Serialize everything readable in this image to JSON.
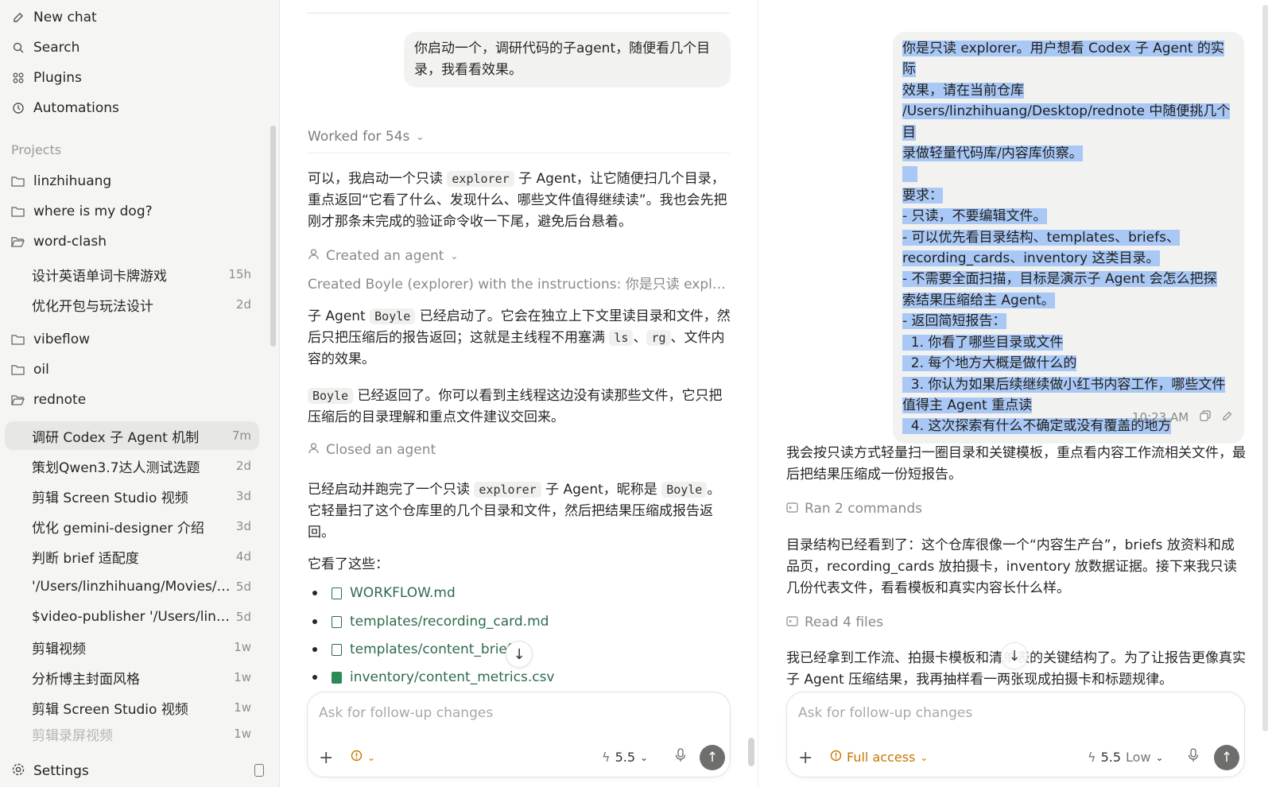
{
  "sidebar": {
    "nav": [
      {
        "label": "New chat",
        "icon": "edit-icon"
      },
      {
        "label": "Search",
        "icon": "search-icon"
      },
      {
        "label": "Plugins",
        "icon": "plugins-icon"
      },
      {
        "label": "Automations",
        "icon": "clock-icon"
      }
    ],
    "projects_label": "Projects",
    "projects": [
      {
        "name": "linzhihuang"
      },
      {
        "name": "where is my dog?"
      },
      {
        "name": "word-clash",
        "threads": [
          {
            "title": "设计英语单词卡牌游戏",
            "age": "15h"
          },
          {
            "title": "优化开包与玩法设计",
            "age": "2d"
          }
        ]
      },
      {
        "name": "vibeflow"
      },
      {
        "name": "oil"
      },
      {
        "name": "rednote",
        "threads": [
          {
            "title": "调研 Codex 子 Agent 机制",
            "age": "7m"
          },
          {
            "title": "策划Qwen3.7达人测试选题",
            "age": "2d"
          },
          {
            "title": "剪辑 Screen Studio 视频",
            "age": "3d"
          },
          {
            "title": "优化 gemini-designer 介绍",
            "age": "3d"
          },
          {
            "title": "判断 brief 适配度",
            "age": "4d"
          },
          {
            "title": "'/Users/linzhihuang/Movies/e...",
            "age": "5d"
          },
          {
            "title": "$video-publisher '/Users/linz...",
            "age": "5d"
          },
          {
            "title": "剪辑视频",
            "age": "1w"
          },
          {
            "title": "分析博主封面风格",
            "age": "1w"
          },
          {
            "title": "剪辑 Screen Studio 视频",
            "age": "1w"
          },
          {
            "title": "剪辑录屏视频",
            "age": "1w"
          }
        ]
      }
    ],
    "settings_label": "Settings"
  },
  "middle": {
    "user_message": "你启动一个，调研代码的子agent，随便看几个目录，我看看效果。",
    "worked_label": "Worked for 54s",
    "p1_a": "可以，我启动一个只读 ",
    "p1_code": "explorer",
    "p1_b": " 子 Agent，让它随便扫几个目录，重点返回“它看了什么、发现什么、哪些文件值得继续读”。我也会先把刚才那条未完成的验证命令收一下尾，避免后台悬着。",
    "created_label": "Created an agent",
    "created_desc": "Created Boyle (explorer) with the instructions: 你是只读 explorer...",
    "p2_a": "子 Agent ",
    "p2_code1": "Boyle",
    "p2_b": " 已经启动了。它会在独立上下文里读目录和文件，然后只把压缩后的报告返回；这就是主线程不用塞满 ",
    "p2_code2": "ls",
    "p2_c": "、",
    "p2_code3": "rg",
    "p2_d": "、文件内容的效果。",
    "p3_code": "Boyle",
    "p3_b": " 已经返回了。你可以看到主线程这边没有读那些文件，它只把压缩后的目录理解和重点文件建议交回来。",
    "closed_label": "Closed an agent",
    "p4_a": "已经启动并跑完了一个只读 ",
    "p4_code1": "explorer",
    "p4_b": " 子 Agent，昵称是 ",
    "p4_code2": "Boyle",
    "p4_c": "。它轻量扫了这个仓库里的几个目录和文件，然后把结果压缩成报告返回。",
    "p5": "它看了这些：",
    "files": [
      "WORKFLOW.md",
      "templates/recording_card.md",
      "templates/content_brief.",
      "inventory/content_metrics.csv"
    ],
    "composer": {
      "placeholder": "Ask for follow-up changes",
      "model": "5.5"
    }
  },
  "right": {
    "user_message_lines": [
      "你是只读 explorer。用户想看 Codex 子 Agent 的实际",
      "效果，请在当前仓库",
      "/Users/linzhihuang/Desktop/rednote 中随便挑几个目",
      "录做轻量代码库/内容库侦察。",
      " ",
      "要求：",
      "- 只读，不要编辑文件。",
      "- 可以优先看目录结构、templates、briefs、",
      "recording_cards、inventory 这类目录。",
      "- 不需要全面扫描，目标是演示子 Agent 会怎么把探",
      "索结果压缩给主 Agent。",
      "- 返回简短报告：",
      "  1. 你看了哪些目录或文件",
      "  2. 每个地方大概是做什么的",
      "  3. 你认为如果后续继续做小红书内容工作，哪些文件",
      "值得主 Agent 重点读",
      "  4. 这次探索有什么不确定或没有覆盖的地方"
    ],
    "time": "10:23 AM",
    "p1": "我会按只读方式轻量扫一圈目录和关键模板，重点看内容工作流相关文件，最后把结果压缩成一份短报告。",
    "ran_label": "Ran 2 commands",
    "p2": "目录结构已经看到了：这个仓库很像一个“内容生产台”，briefs 放资料和成品页，recording_cards 放拍摄卡，inventory 放数据证据。接下来我只读几份代表文件，看看模板和真实内容长什么样。",
    "read_label": "Read 4 files",
    "p3": "我已经拿到工作流、拍摄卡模板和清单表的关键结构了。为了让报告更像真实子 Agent 压缩结果，我再抽样看一两张现成拍摄卡和标题规律。",
    "composer": {
      "placeholder": "Ask for follow-up changes",
      "access": "Full access",
      "model": "5.5",
      "effort": "Low"
    }
  }
}
